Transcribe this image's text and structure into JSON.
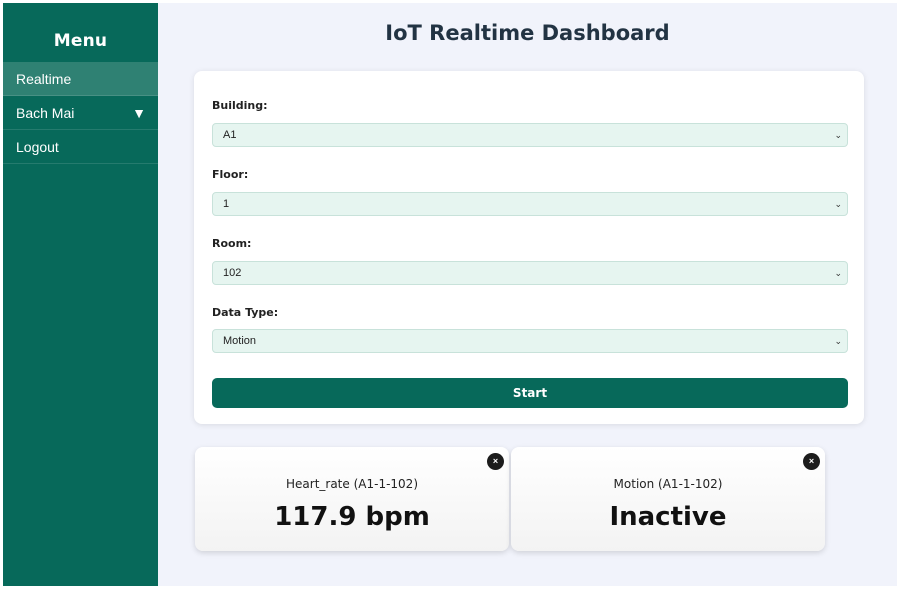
{
  "sidebar": {
    "title": "Menu",
    "items": [
      {
        "label": "Realtime",
        "active": true
      },
      {
        "label": "Bach Mai",
        "caret": "▼"
      },
      {
        "label": "Logout"
      }
    ]
  },
  "header": {
    "title": "IoT Realtime Dashboard"
  },
  "form": {
    "building": {
      "label": "Building:",
      "value": "A1"
    },
    "floor": {
      "label": "Floor:",
      "value": "1"
    },
    "room": {
      "label": "Room:",
      "value": "102"
    },
    "data_type": {
      "label": "Data Type:",
      "value": "Motion"
    },
    "chevron": "⌄",
    "start_label": "Start"
  },
  "cards": [
    {
      "title": "Heart_rate (A1-1-102)",
      "value": "117.9 bpm",
      "close": "×"
    },
    {
      "title": "Motion (A1-1-102)",
      "value": "Inactive",
      "close": "×"
    }
  ],
  "colors": {
    "sidebar_bg": "#07695a",
    "active_item_bg": "#2f8173",
    "page_bg": "#f1f3fb",
    "select_bg": "#e6f5f0",
    "button_bg": "#07695a"
  }
}
